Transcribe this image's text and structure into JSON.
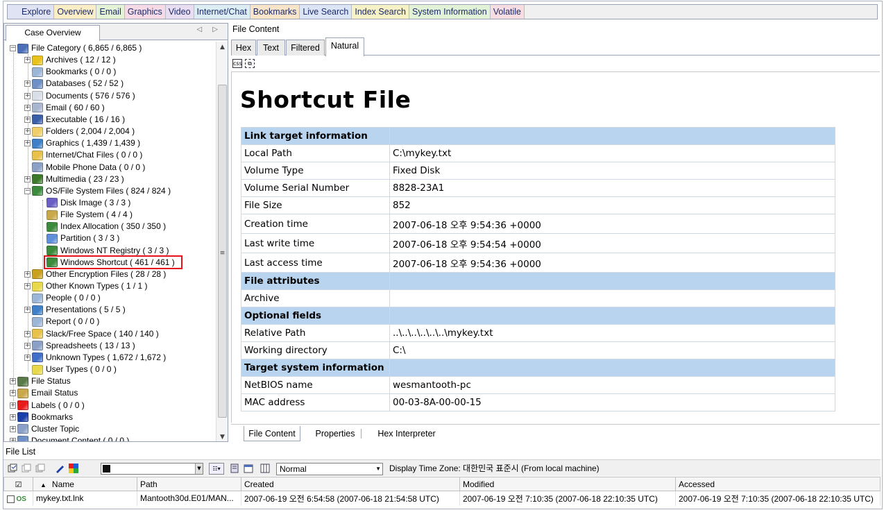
{
  "top_tabs": [
    {
      "label": "Explore",
      "color": "#dfe3f4"
    },
    {
      "label": "Overview",
      "color": "#fbeec6",
      "active": true
    },
    {
      "label": "Email",
      "color": "#e4f3d6"
    },
    {
      "label": "Graphics",
      "color": "#f6dbe6"
    },
    {
      "label": "Video",
      "color": "#e9ddf2"
    },
    {
      "label": "Internet/Chat",
      "color": "#dceef4"
    },
    {
      "label": "Bookmarks",
      "color": "#f8e4c8"
    },
    {
      "label": "Live Search",
      "color": "#dbe5f6"
    },
    {
      "label": "Index Search",
      "color": "#f7f1c6"
    },
    {
      "label": "System Information",
      "color": "#e2f2d7"
    },
    {
      "label": "Volatile",
      "color": "#f5dde1"
    }
  ],
  "left": {
    "tab_label": "Case Overview",
    "tab_scroll": "◁ ▷"
  },
  "tree": [
    {
      "label": "File Category ( 6,865 / 6,865 )",
      "icon": "file-category-icon",
      "color": "#4a6fb8",
      "level": 0,
      "expander": "−"
    },
    {
      "label": "Archives ( 12 / 12 )",
      "icon": "archives-icon",
      "color": "#e8c21a",
      "level": 1,
      "expander": "+"
    },
    {
      "label": "Bookmarks ( 0 / 0 )",
      "icon": "bookmarks-icon",
      "color": "#9cb6d8",
      "level": 1,
      "expander": ""
    },
    {
      "label": "Databases ( 52 / 52 )",
      "icon": "databases-icon",
      "color": "#6f8fc7",
      "level": 1,
      "expander": "+"
    },
    {
      "label": "Documents ( 576 / 576 )",
      "icon": "documents-icon",
      "color": "#d9dfe8",
      "level": 1,
      "expander": "+"
    },
    {
      "label": "Email ( 60 / 60 )",
      "icon": "email-icon",
      "color": "#a8b6d0",
      "level": 1,
      "expander": "+"
    },
    {
      "label": "Executable ( 16 / 16 )",
      "icon": "executable-icon",
      "color": "#3a5fa8",
      "level": 1,
      "expander": "+"
    },
    {
      "label": "Folders ( 2,004 / 2,004 )",
      "icon": "folder-icon",
      "color": "#f0cf6a",
      "level": 1,
      "expander": "+"
    },
    {
      "label": "Graphics ( 1,439 / 1,439 )",
      "icon": "graphics-icon",
      "color": "#3f80c9",
      "level": 1,
      "expander": "+"
    },
    {
      "label": "Internet/Chat Files ( 0 / 0 )",
      "icon": "internet-chat-icon",
      "color": "#e8c14a",
      "level": 1,
      "expander": ""
    },
    {
      "label": "Mobile Phone Data ( 0 / 0 )",
      "icon": "mobile-phone-icon",
      "color": "#8aa0c6",
      "level": 1,
      "expander": ""
    },
    {
      "label": "Multimedia ( 23 / 23 )",
      "icon": "multimedia-icon",
      "color": "#3c7a2a",
      "level": 1,
      "expander": "+"
    },
    {
      "label": "OS/File System Files ( 824 / 824 )",
      "icon": "os-file-system-icon",
      "color": "#3c8a3c",
      "level": 1,
      "expander": "−"
    },
    {
      "label": "Disk Image ( 3 / 3 )",
      "icon": "disk-image-icon",
      "color": "#6b5fc4",
      "level": 2,
      "expander": ""
    },
    {
      "label": "File System ( 4 / 4 )",
      "icon": "file-system-icon",
      "color": "#c9a84a",
      "level": 2,
      "expander": ""
    },
    {
      "label": "Index Allocation ( 350 / 350 )",
      "icon": "index-allocation-icon",
      "color": "#3c8a3c",
      "level": 2,
      "expander": ""
    },
    {
      "label": "Partition ( 3 / 3 )",
      "icon": "partition-icon",
      "color": "#5f8fd8",
      "level": 2,
      "expander": ""
    },
    {
      "label": "Windows NT Registry ( 3 / 3 )",
      "icon": "windows-nt-registry-icon",
      "color": "#3c8a3c",
      "level": 2,
      "expander": ""
    },
    {
      "label": "Windows Shortcut ( 461 / 461 )",
      "icon": "windows-shortcut-icon",
      "color": "#3c8a3c",
      "level": 2,
      "expander": ""
    },
    {
      "label": "Other Encryption Files ( 28 / 28 )",
      "icon": "encryption-icon",
      "color": "#c9a020",
      "level": 1,
      "expander": "+"
    },
    {
      "label": "Other Known Types ( 1 / 1 )",
      "icon": "known-types-icon",
      "color": "#e8d84a",
      "level": 1,
      "expander": "+"
    },
    {
      "label": "People ( 0 / 0 )",
      "icon": "people-icon",
      "color": "#9cb6d8",
      "level": 1,
      "expander": ""
    },
    {
      "label": "Presentations ( 5 / 5 )",
      "icon": "presentations-icon",
      "color": "#3f80c9",
      "level": 1,
      "expander": "+"
    },
    {
      "label": "Report ( 0 / 0 )",
      "icon": "report-icon",
      "color": "#9cb6d8",
      "level": 1,
      "expander": ""
    },
    {
      "label": "Slack/Free Space ( 140 / 140 )",
      "icon": "slack-space-icon",
      "color": "#e8c14a",
      "level": 1,
      "expander": "+"
    },
    {
      "label": "Spreadsheets ( 13 / 13 )",
      "icon": "spreadsheets-icon",
      "color": "#8aa0c6",
      "level": 1,
      "expander": "+"
    },
    {
      "label": "Unknown Types ( 1,672 / 1,672 )",
      "icon": "unknown-types-icon",
      "color": "#3f6fc9",
      "level": 1,
      "expander": "+"
    },
    {
      "label": "User Types ( 0 / 0 )",
      "icon": "user-types-icon",
      "color": "#e8d84a",
      "level": 1,
      "expander": ""
    },
    {
      "label": "File Status",
      "icon": "file-status-icon",
      "color": "#5a7a4a",
      "level": 0,
      "expander": "+"
    },
    {
      "label": "Email Status",
      "icon": "email-status-icon",
      "color": "#c9a84a",
      "level": 0,
      "expander": "+"
    },
    {
      "label": "Labels ( 0 / 0 )",
      "icon": "labels-icon",
      "color": "#e81a1a",
      "level": 0,
      "expander": "+"
    },
    {
      "label": "Bookmarks",
      "icon": "bookmarks-pen-icon",
      "color": "#1a3fa8",
      "level": 0,
      "expander": "+"
    },
    {
      "label": "Cluster Topic",
      "icon": "cluster-topic-icon",
      "color": "#8aa0c6",
      "level": 0,
      "expander": "+"
    },
    {
      "label": "Document Content ( 0 / 0 )",
      "icon": "document-content-icon",
      "color": "#6f8fc7",
      "level": 0,
      "expander": "+"
    }
  ],
  "right": {
    "pane_title": "File Content",
    "view_tabs": [
      "Hex",
      "Text",
      "Filtered",
      "Natural"
    ],
    "heading": "Shortcut File",
    "table": [
      {
        "type": "section",
        "label": "Link target information",
        "value": ""
      },
      {
        "type": "row",
        "label": "Local Path",
        "value": "C:\\mykey.txt"
      },
      {
        "type": "row",
        "label": "Volume Type",
        "value": "Fixed Disk"
      },
      {
        "type": "row",
        "label": "Volume Serial Number",
        "value": "8828-23A1"
      },
      {
        "type": "row",
        "label": "File Size",
        "value": "852"
      },
      {
        "type": "row",
        "label": "Creation time",
        "value": "2007-06-18 오후 9:54:36 +0000",
        "tall": true
      },
      {
        "type": "row",
        "label": "Last write time",
        "value": "2007-06-18 오후 9:54:54 +0000",
        "tall": true
      },
      {
        "type": "row",
        "label": "Last access time",
        "value": "2007-06-18 오후 9:54:36 +0000",
        "tall": true
      },
      {
        "type": "section",
        "label": "File attributes",
        "value": ""
      },
      {
        "type": "row",
        "label": "Archive",
        "value": ""
      },
      {
        "type": "section",
        "label": "Optional fields",
        "value": ""
      },
      {
        "type": "row",
        "label": "Relative Path",
        "value": "..\\..\\..\\..\\..\\..\\mykey.txt"
      },
      {
        "type": "row",
        "label": "Working directory",
        "value": "C:\\"
      },
      {
        "type": "section",
        "label": "Target system information",
        "value": ""
      },
      {
        "type": "row",
        "label": "NetBIOS name",
        "value": "wesmantooth-pc"
      },
      {
        "type": "row",
        "label": "MAC address",
        "value": "00-03-8A-00-00-15"
      }
    ],
    "bottom_tabs": [
      "File Content",
      "Properties",
      "Hex Interpreter"
    ]
  },
  "file_list": {
    "title": "File List",
    "view_mode": "Normal",
    "timezone_label": "Display Time Zone: 대한민국 표준시  (From local machine)",
    "columns": [
      "Name",
      "Path",
      "Created",
      "Modified",
      "Accessed"
    ],
    "rows": [
      {
        "name": "mykey.txt.lnk",
        "path": "Mantooth30d.E01/MAN...",
        "created": "2007-06-19 오전 6:54:58 (2007-06-18 21:54:58 UTC)",
        "modified": "2007-06-19 오전 7:10:35 (2007-06-18 22:10:35 UTC)",
        "accessed": "2007-06-19 오전 7:10:35 (2007-06-18 22:10:35 UTC)"
      }
    ]
  }
}
